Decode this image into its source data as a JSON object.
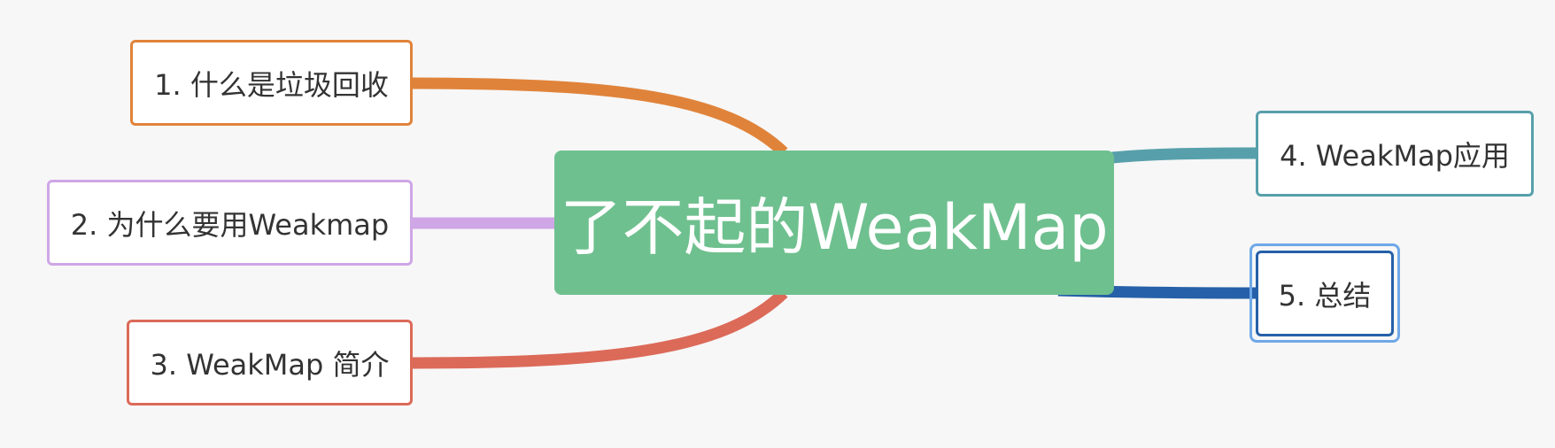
{
  "central": {
    "label": "了不起的WeakMap",
    "color": "#6fc08f"
  },
  "topics": [
    {
      "id": "gc",
      "label": "1. 什么是垃圾回收",
      "color": "#e0833a",
      "side": "left"
    },
    {
      "id": "why",
      "label": "2. 为什么要用Weakmap",
      "color": "#cfa6e6",
      "side": "left"
    },
    {
      "id": "intro",
      "label": "3. WeakMap 简介",
      "color": "#dc6a59",
      "side": "left"
    },
    {
      "id": "usage",
      "label": "4. WeakMap应用",
      "color": "#57a0ab",
      "side": "right"
    },
    {
      "id": "summary",
      "label": "5. 总结",
      "color": "#2660a8",
      "side": "right",
      "selected": true
    }
  ],
  "selection_color": "#6fa8e8",
  "background": "#f7f7f7"
}
